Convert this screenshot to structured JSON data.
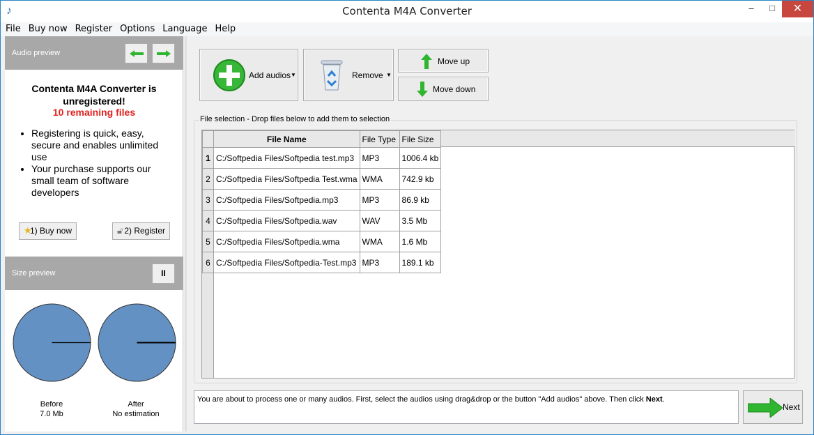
{
  "window": {
    "title": "Contenta M4A Converter",
    "minimize": "–",
    "maximize": "□",
    "close": "✕"
  },
  "menu": [
    "File",
    "Buy now",
    "Register",
    "Options",
    "Language",
    "Help"
  ],
  "audio_preview": {
    "label": "Audio preview",
    "prev_icon": "left-arrow-icon",
    "next_icon": "right-arrow-icon"
  },
  "registration": {
    "title_line1": "Contenta M4A Converter is",
    "title_line2": "unregistered!",
    "remaining": "10 remaining files",
    "bullets": [
      "Registering is quick, easy, secure and enables unlimited use",
      "Your purchase supports our small team of software developers"
    ],
    "buy_button": "1) Buy now",
    "register_button": "2) Register",
    "colors": {
      "remaining": "#e0211f"
    }
  },
  "size_preview": {
    "label": "Size preview",
    "pause_label": "II",
    "before_label": "Before",
    "before_value": "7.0 Mb",
    "after_label": "After",
    "after_value": "No estimation",
    "pie_color": "#6391c3"
  },
  "toolbar": {
    "add": "Add audios",
    "remove": "Remove",
    "move_up": "Move up",
    "move_down": "Move down"
  },
  "file_selection": {
    "group_label": "File selection - Drop files below to add them to selection",
    "columns": [
      "File Name",
      "File Type",
      "File Size"
    ],
    "rows": [
      {
        "num": "1",
        "name": "C:/Softpedia Files/Softpedia test.mp3",
        "type": "MP3",
        "size": "1006.4 kb"
      },
      {
        "num": "2",
        "name": "C:/Softpedia Files/Softpedia Test.wma",
        "type": "WMA",
        "size": "742.9 kb"
      },
      {
        "num": "3",
        "name": "C:/Softpedia Files/Softpedia.mp3",
        "type": "MP3",
        "size": "86.9 kb"
      },
      {
        "num": "4",
        "name": "C:/Softpedia Files/Softpedia.wav",
        "type": "WAV",
        "size": "3.5 Mb"
      },
      {
        "num": "5",
        "name": "C:/Softpedia Files/Softpedia.wma",
        "type": "WMA",
        "size": "1.6 Mb"
      },
      {
        "num": "6",
        "name": "C:/Softpedia Files/Softpedia-Test.mp3",
        "type": "MP3",
        "size": "189.1 kb"
      }
    ]
  },
  "status": {
    "text": "You are about to process one or many audios. First, select the audios using drag&drop or the button \"Add audios\" above. Then click",
    "bold": "Next",
    "end": "."
  },
  "next_button": "Next"
}
